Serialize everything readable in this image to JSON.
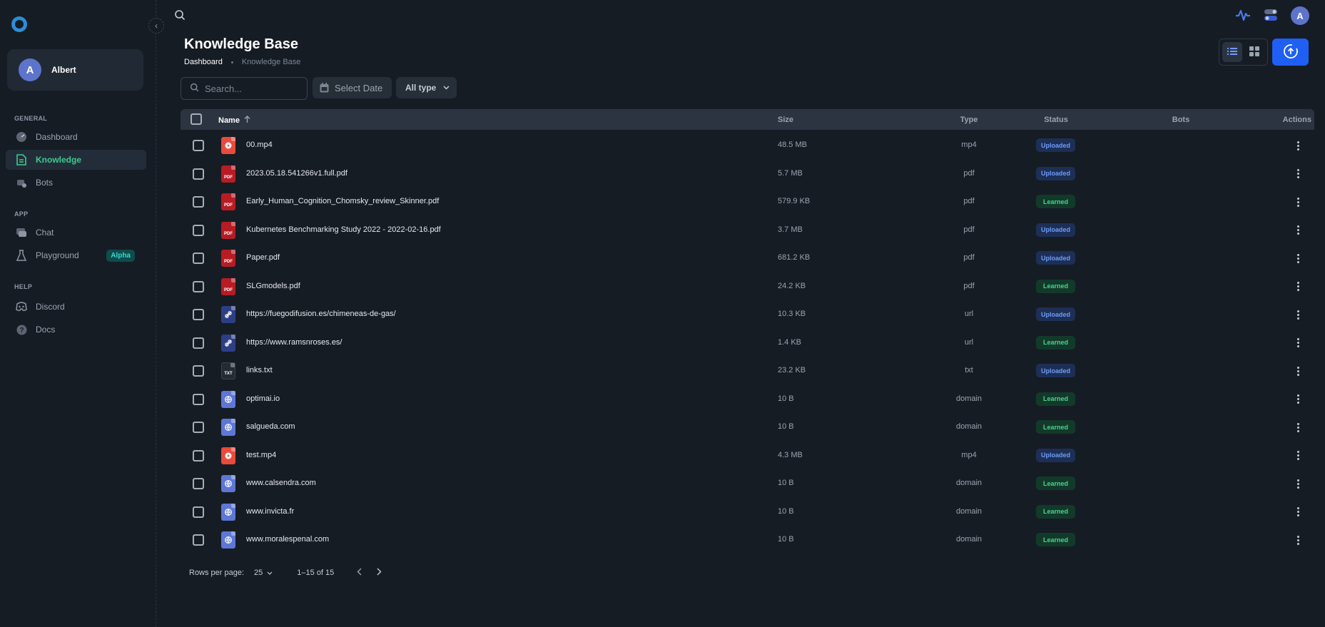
{
  "sidebar": {
    "user": {
      "initial": "A",
      "name": "Albert"
    },
    "sections": [
      {
        "label": "GENERAL",
        "items": [
          {
            "label": "Dashboard",
            "icon": "dashboard-icon",
            "active": false
          },
          {
            "label": "Knowledge",
            "icon": "knowledge-icon",
            "active": true
          },
          {
            "label": "Bots",
            "icon": "bots-icon",
            "active": false
          }
        ]
      },
      {
        "label": "APP",
        "items": [
          {
            "label": "Chat",
            "icon": "chat-icon",
            "active": false
          },
          {
            "label": "Playground",
            "icon": "flask-icon",
            "active": false,
            "badge": "Alpha"
          }
        ]
      },
      {
        "label": "HELP",
        "items": [
          {
            "label": "Discord",
            "icon": "discord-icon",
            "active": false
          },
          {
            "label": "Docs",
            "icon": "help-icon",
            "active": false
          }
        ]
      }
    ]
  },
  "header": {
    "avatar_initial": "A"
  },
  "page": {
    "title": "Knowledge Base",
    "breadcrumb": [
      "Dashboard",
      "Knowledge Base"
    ]
  },
  "filters": {
    "search_placeholder": "Search...",
    "date_label": "Select Date",
    "type_label": "All type"
  },
  "table": {
    "columns": {
      "name": "Name",
      "size": "Size",
      "type": "Type",
      "status": "Status",
      "bots": "Bots",
      "actions": "Actions"
    },
    "rows": [
      {
        "name": "00.mp4",
        "size": "48.5 MB",
        "type": "mp4",
        "status": "Uploaded"
      },
      {
        "name": "2023.05.18.541266v1.full.pdf",
        "size": "5.7 MB",
        "type": "pdf",
        "status": "Uploaded"
      },
      {
        "name": "Early_Human_Cognition_Chomsky_review_Skinner.pdf",
        "size": "579.9 KB",
        "type": "pdf",
        "status": "Learned"
      },
      {
        "name": "Kubernetes Benchmarking Study 2022 - 2022-02-16.pdf",
        "size": "3.7 MB",
        "type": "pdf",
        "status": "Uploaded"
      },
      {
        "name": "Paper.pdf",
        "size": "681.2 KB",
        "type": "pdf",
        "status": "Uploaded"
      },
      {
        "name": "SLGmodels.pdf",
        "size": "24.2 KB",
        "type": "pdf",
        "status": "Learned"
      },
      {
        "name": "https://fuegodifusion.es/chimeneas-de-gas/",
        "size": "10.3 KB",
        "type": "url",
        "status": "Uploaded"
      },
      {
        "name": "https://www.ramsnroses.es/",
        "size": "1.4 KB",
        "type": "url",
        "status": "Learned"
      },
      {
        "name": "links.txt",
        "size": "23.2 KB",
        "type": "txt",
        "status": "Uploaded"
      },
      {
        "name": "optimai.io",
        "size": "10 B",
        "type": "domain",
        "status": "Learned"
      },
      {
        "name": "salgueda.com",
        "size": "10 B",
        "type": "domain",
        "status": "Learned"
      },
      {
        "name": "test.mp4",
        "size": "4.3 MB",
        "type": "mp4",
        "status": "Uploaded"
      },
      {
        "name": "www.calsendra.com",
        "size": "10 B",
        "type": "domain",
        "status": "Learned"
      },
      {
        "name": "www.invicta.fr",
        "size": "10 B",
        "type": "domain",
        "status": "Learned"
      },
      {
        "name": "www.moralespenal.com",
        "size": "10 B",
        "type": "domain",
        "status": "Learned"
      }
    ]
  },
  "pagination": {
    "rows_per_page_label": "Rows per page:",
    "rows_per_page": "25",
    "range": "1–15 of 15"
  },
  "colors": {
    "accent": "#1f5ff4",
    "active_nav": "#3ccb8c",
    "pdf": "#b71c24",
    "mp4": "#ea4a3c",
    "domain": "#5e77d6"
  }
}
